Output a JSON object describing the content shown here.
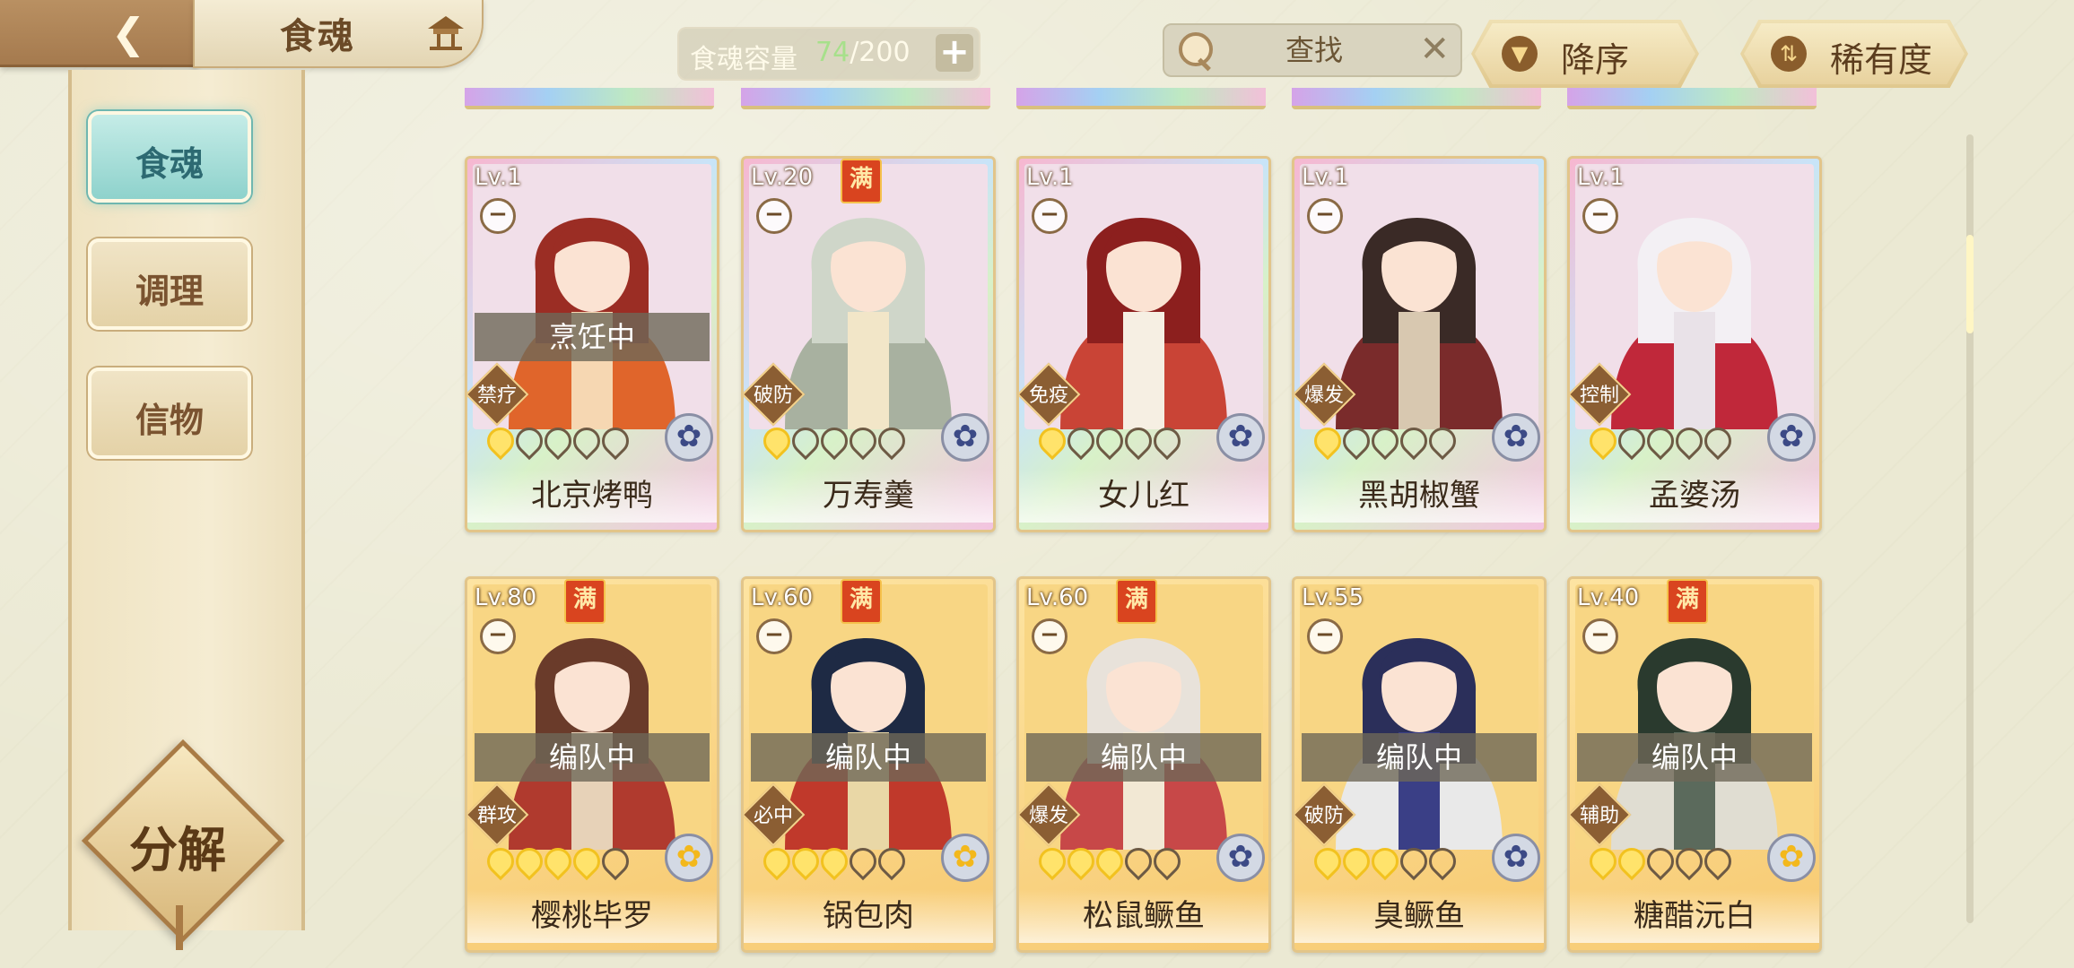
{
  "header": {
    "title": "食魂",
    "capacity_label": "食魂容量",
    "capacity_current": "74",
    "capacity_max": "/200",
    "capacity_add": "+",
    "search_placeholder": "查找",
    "search_clear": "✕",
    "sort_order": "降序",
    "sort_by": "稀有度"
  },
  "sidebar": {
    "tabs": [
      {
        "label": "食魂"
      },
      {
        "label": "调理"
      },
      {
        "label": "信物"
      }
    ],
    "decompose_label": "分解"
  },
  "cards": [
    {
      "level": "Lv.1",
      "full": "",
      "status": "烹饪中",
      "trait": "禁疗",
      "stars_on": 1,
      "name": "北京烤鸭",
      "style": "rainbow",
      "element": "blue"
    },
    {
      "level": "Lv.20",
      "full": "满",
      "status": "",
      "trait": "破防",
      "stars_on": 1,
      "name": "万寿羹",
      "style": "rainbow",
      "element": "blue"
    },
    {
      "level": "Lv.1",
      "full": "",
      "status": "",
      "trait": "免疫",
      "stars_on": 1,
      "name": "女儿红",
      "style": "rainbow",
      "element": "blue"
    },
    {
      "level": "Lv.1",
      "full": "",
      "status": "",
      "trait": "爆发",
      "stars_on": 1,
      "name": "黑胡椒蟹",
      "style": "rainbow",
      "element": "blue"
    },
    {
      "level": "Lv.1",
      "full": "",
      "status": "",
      "trait": "控制",
      "stars_on": 1,
      "name": "孟婆汤",
      "style": "rainbow",
      "element": "blue"
    },
    {
      "level": "Lv.80",
      "full": "满",
      "status": "编队中",
      "trait": "群攻",
      "stars_on": 4,
      "name": "樱桃毕罗",
      "style": "gold",
      "element": "gold"
    },
    {
      "level": "Lv.60",
      "full": "满",
      "status": "编队中",
      "trait": "必中",
      "stars_on": 3,
      "name": "锅包肉",
      "style": "gold",
      "element": "gold"
    },
    {
      "level": "Lv.60",
      "full": "满",
      "status": "编队中",
      "trait": "爆发",
      "stars_on": 3,
      "name": "松鼠鳜鱼",
      "style": "gold",
      "element": "blue"
    },
    {
      "level": "Lv.55",
      "full": "",
      "status": "编队中",
      "trait": "破防",
      "stars_on": 3,
      "name": "臭鳜鱼",
      "style": "gold",
      "element": "blue"
    },
    {
      "level": "Lv.40",
      "full": "满",
      "status": "编队中",
      "trait": "辅助",
      "stars_on": 2,
      "name": "糖醋沅白",
      "style": "gold",
      "element": "gold"
    }
  ],
  "colors": {
    "accent_teal": "#8ed2cc",
    "brown": "#a57a4e",
    "gold": "#f7c970",
    "full_badge": "#d9441f"
  }
}
